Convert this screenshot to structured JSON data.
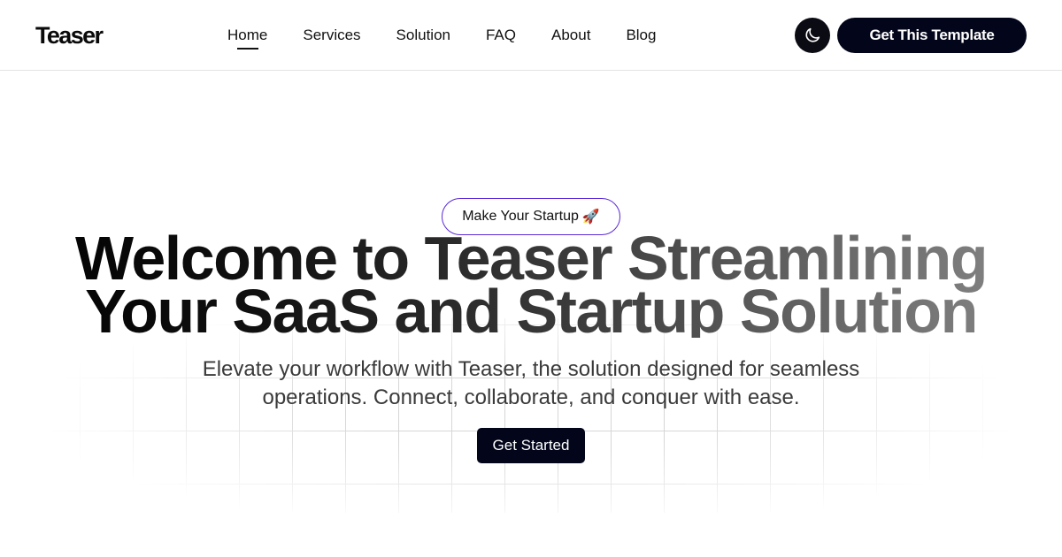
{
  "header": {
    "logo": "Teaser",
    "nav": [
      {
        "label": "Home",
        "active": true
      },
      {
        "label": "Services"
      },
      {
        "label": "Solution"
      },
      {
        "label": "FAQ"
      },
      {
        "label": "About"
      },
      {
        "label": "Blog"
      }
    ],
    "theme_toggle_icon": "moon-icon",
    "cta_label": "Get This Template"
  },
  "hero": {
    "badge_text": "Make Your Startup",
    "badge_icon": "rocket-icon",
    "headline_line1": "Welcome to Teaser Streamlining",
    "headline_line2": "Your SaaS and Startup Solution",
    "subtitle_line1": "Elevate your workflow with Teaser, the solution designed for seamless",
    "subtitle_line2": "operations. Connect, collaborate, and conquer with ease.",
    "cta_label": "Get Started"
  },
  "colors": {
    "primary_dark": "#03061a",
    "badge_border": "#5b2ad6",
    "text": "#111111"
  }
}
